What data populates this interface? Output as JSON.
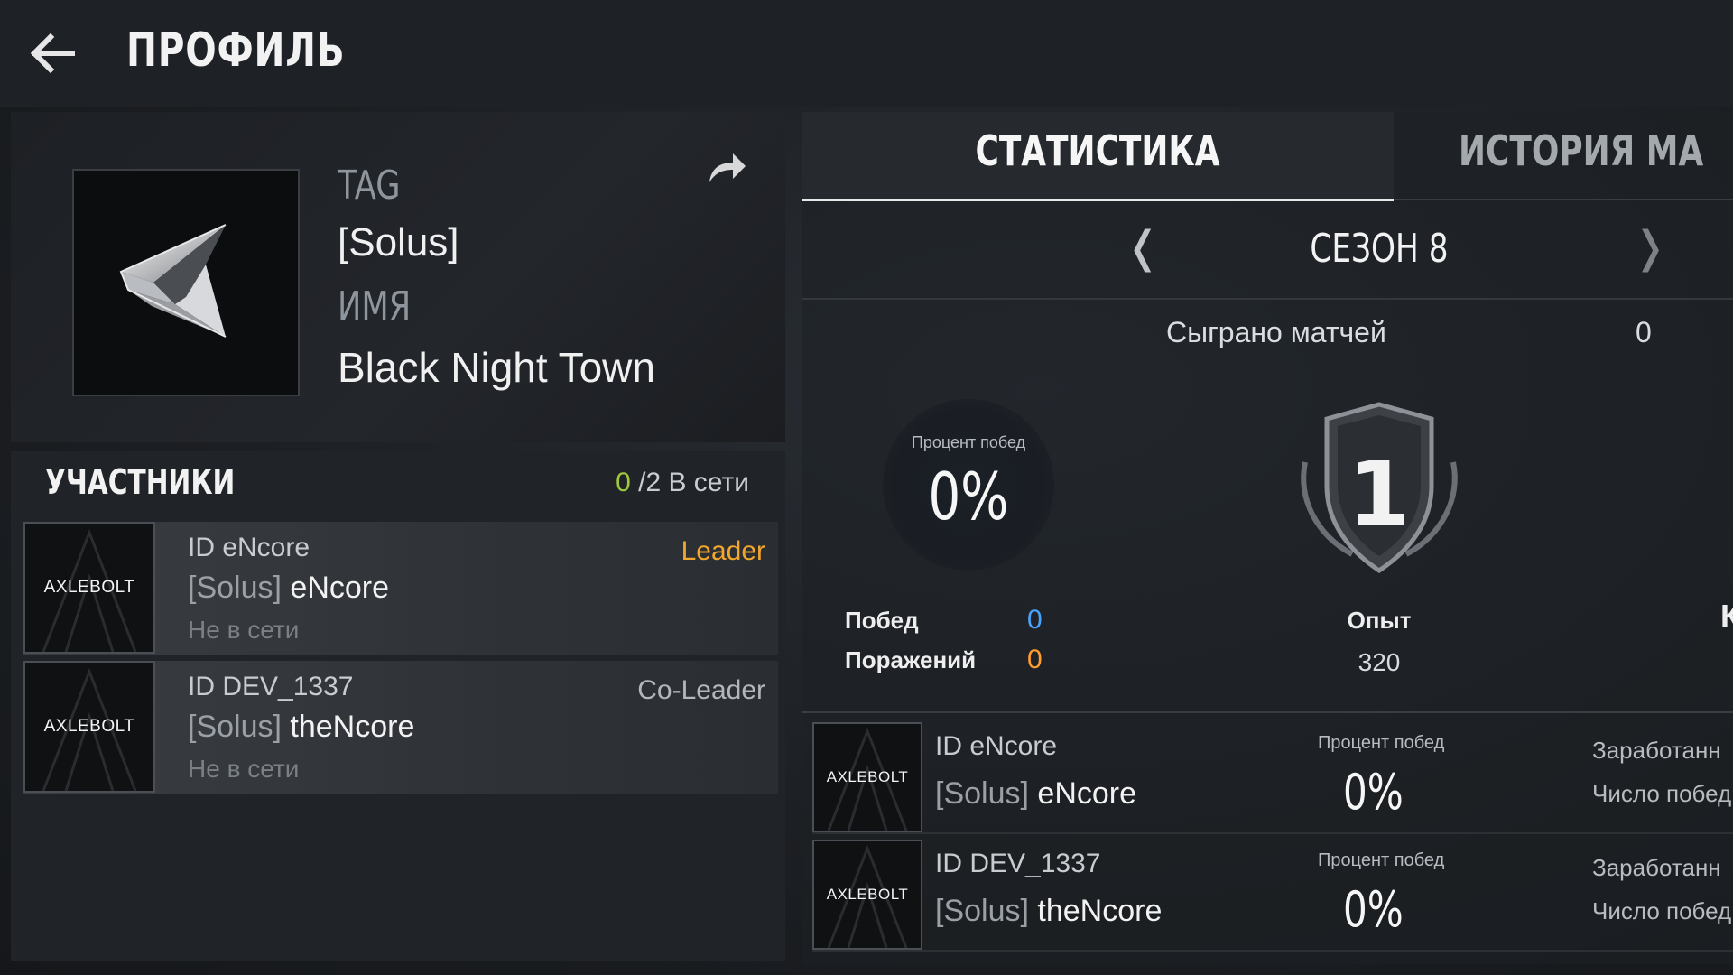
{
  "header": {
    "title": "ПРОФИЛЬ"
  },
  "profile": {
    "tag_label": "TAG",
    "tag_value": "[Solus]",
    "name_label": "ИМЯ",
    "name_value": "Black Night Town"
  },
  "members": {
    "title": "УЧАСТНИКИ",
    "online_num": "0",
    "online_rest": "/2 В сети",
    "items": [
      {
        "avatar_logo": "AXLEBOLT",
        "id": "ID eNcore",
        "tag": "[Solus]",
        "name": "eNcore",
        "status": "Не в сети",
        "role": "Leader",
        "role_color": "#f2a62c"
      },
      {
        "avatar_logo": "AXLEBOLT",
        "id": "ID DEV_1337",
        "tag": "[Solus]",
        "name": "theNcore",
        "status": "Не в сети",
        "role": "Co-Leader",
        "role_color": "#b3b7bc"
      }
    ]
  },
  "stats": {
    "tabs": {
      "statistics": "СТАТИСТИКА",
      "history": "ИСТОРИЯ МА"
    },
    "season": {
      "prev": "❬",
      "label": "СЕЗОН 8",
      "next": "❭"
    },
    "matches_label": "Сыграно матчей",
    "matches_value": "0",
    "winrate_label": "Процент побед",
    "winrate_value": "0%",
    "wins_label": "Побед",
    "wins_value": "0",
    "losses_label": "Поражений",
    "losses_value": "0",
    "rank": "1",
    "exp_label": "Опыт",
    "exp_value": "320",
    "cut_label": "К",
    "rows": [
      {
        "avatar_logo": "AXLEBOLT",
        "id": "ID eNcore",
        "tag": "[Solus]",
        "name": "eNcore",
        "winrate_label": "Процент побед",
        "winrate_value": "0%",
        "earned_label": "Заработанн",
        "wins_label": "Число побед"
      },
      {
        "avatar_logo": "AXLEBOLT",
        "id": "ID DEV_1337",
        "tag": "[Solus]",
        "name": "theNcore",
        "winrate_label": "Процент побед",
        "winrate_value": "0%",
        "earned_label": "Заработанн",
        "wins_label": "Число побед"
      }
    ]
  },
  "colors": {
    "accent_green": "#9ec93a",
    "wins_blue": "#49a3ff",
    "losses_orange": "#ff9d2e"
  }
}
